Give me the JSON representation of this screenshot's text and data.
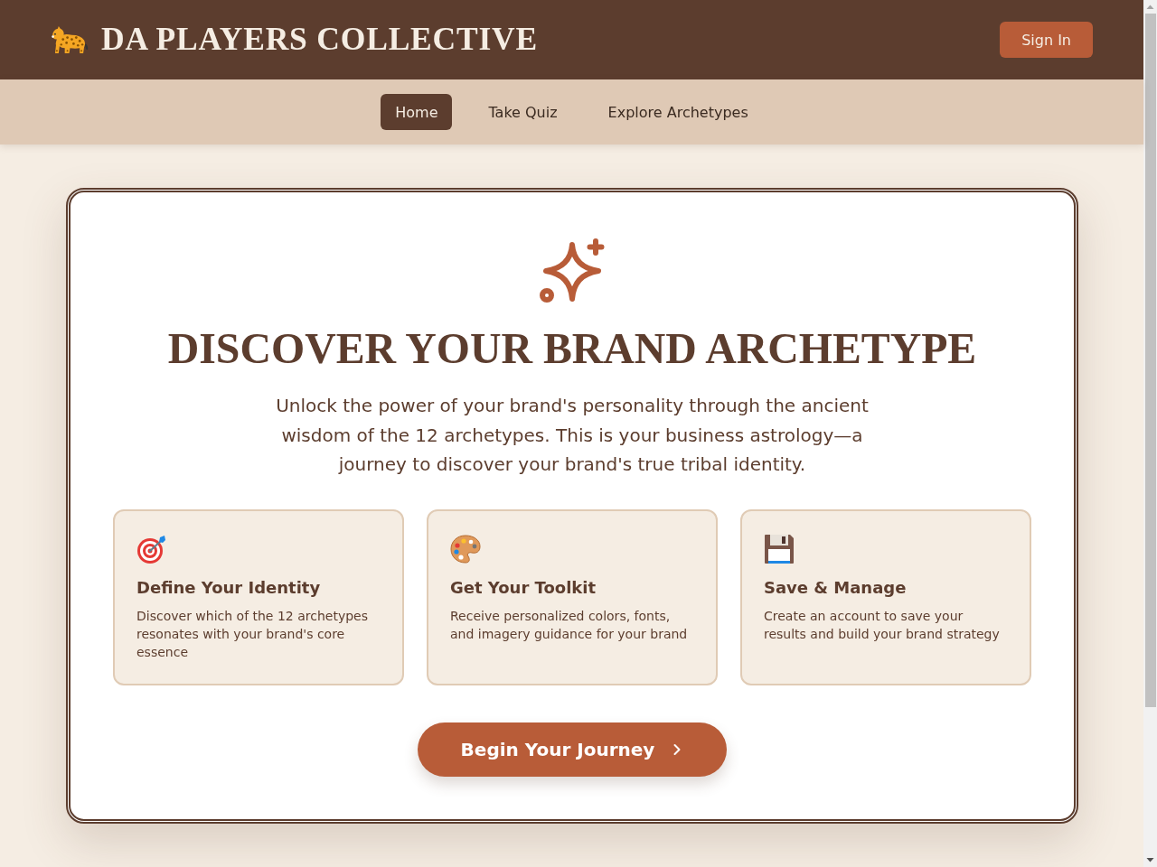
{
  "header": {
    "logo_text": "DA PLAYERS COLLECTIVE",
    "sign_in": "Sign In"
  },
  "nav": {
    "tabs": [
      {
        "label": "Home",
        "selected": true
      },
      {
        "label": "Take Quiz",
        "selected": false
      },
      {
        "label": "Explore Archetypes",
        "selected": false
      }
    ]
  },
  "hero": {
    "title": "DISCOVER YOUR BRAND ARCHETYPE",
    "intro": "Unlock the power of your brand's personality through the ancient wisdom of the 12 archetypes. This is your business astrology—a journey to discover your brand's true tribal identity.",
    "features": [
      {
        "kind": "target",
        "title": "Define Your Identity",
        "text": "Discover which of the 12 archetypes resonates with your brand's core essence"
      },
      {
        "kind": "palette",
        "title": "Get Your Toolkit",
        "text": "Receive personalized colors, fonts, and imagery guidance for your brand"
      },
      {
        "kind": "floppy",
        "title": "Save & Manage",
        "text": "Create an account to save your results and build your brand strategy"
      }
    ],
    "cta": "Begin Your Journey"
  }
}
